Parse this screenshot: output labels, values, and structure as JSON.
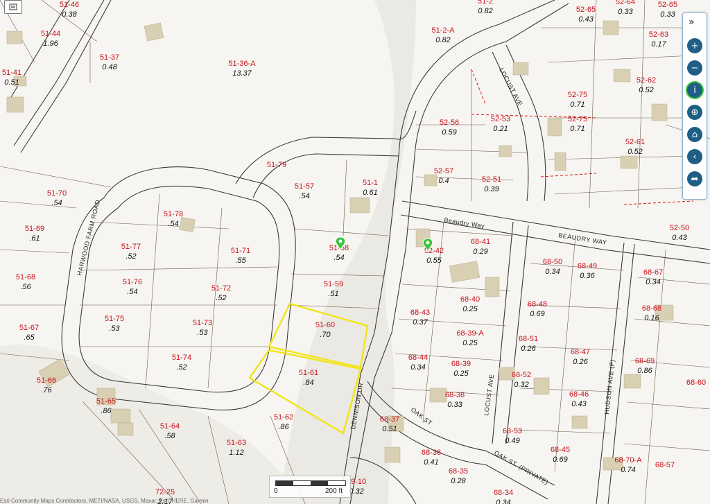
{
  "map": {
    "streets": [
      {
        "id": "harwood",
        "name": "HARWOOD FARM ROAD"
      },
      {
        "id": "dennison",
        "name": "DENNISON DR"
      },
      {
        "id": "locust-n",
        "name": "LOCUST AVE"
      },
      {
        "id": "locust-s",
        "name": "LOCUST AVE"
      },
      {
        "id": "beaudry-way",
        "name": "Beaudry Way"
      },
      {
        "id": "beaudry-way-2",
        "name": "BEAUDRY WAY"
      },
      {
        "id": "oak",
        "name": "OAK ST"
      },
      {
        "id": "oak-private",
        "name": "OAK ST. (PRIVATE)"
      },
      {
        "id": "hudson",
        "name": "HUDSON AVE (P)"
      }
    ],
    "parcels": [
      {
        "id": "51-46",
        "area": "0.38"
      },
      {
        "id": "51-44",
        "area": "1.96"
      },
      {
        "id": "51-41",
        "area": "0.51"
      },
      {
        "id": "51-37",
        "area": "0.48"
      },
      {
        "id": "51-36-A",
        "area": "13.37"
      },
      {
        "id": "51-2",
        "area": "0.82"
      },
      {
        "id": "51-2-A",
        "area": "0.82"
      },
      {
        "id": "52-65",
        "area": "0.43"
      },
      {
        "id": "52-64",
        "area": "0.33"
      },
      {
        "id": "52-65",
        "area": "0.33"
      },
      {
        "id": "52-63",
        "area": "0.17"
      },
      {
        "id": "52-62",
        "area": "0.52"
      },
      {
        "id": "52-75",
        "area": "0.71"
      },
      {
        "id": "52-75",
        "area": "0.71"
      },
      {
        "id": "52-56",
        "area": "0.59"
      },
      {
        "id": "52-53",
        "area": "0.21"
      },
      {
        "id": "52-61",
        "area": "0.52"
      },
      {
        "id": "52-57",
        "area": "0.4"
      },
      {
        "id": "52-51",
        "area": "0.39"
      },
      {
        "id": "51-79",
        "area": ""
      },
      {
        "id": "51-57",
        "area": ".54"
      },
      {
        "id": "51-1",
        "area": "0.61"
      },
      {
        "id": "51-70",
        "area": ".54"
      },
      {
        "id": "51-78",
        "area": ".54"
      },
      {
        "id": "51-69",
        "area": ".61"
      },
      {
        "id": "51-77",
        "area": ".52"
      },
      {
        "id": "51-71",
        "area": ".55"
      },
      {
        "id": "51-58",
        "area": ".54"
      },
      {
        "id": "52-42",
        "area": "0.55"
      },
      {
        "id": "68-41",
        "area": "0.29"
      },
      {
        "id": "52-50",
        "area": "0.43"
      },
      {
        "id": "51-68",
        "area": ".56"
      },
      {
        "id": "51-76",
        "area": ".54"
      },
      {
        "id": "51-72",
        "area": ".52"
      },
      {
        "id": "51-59",
        "area": ".51"
      },
      {
        "id": "68-50",
        "area": "0.34"
      },
      {
        "id": "68-49",
        "area": "0.36"
      },
      {
        "id": "68-67",
        "area": "0.34"
      },
      {
        "id": "68-40",
        "area": "0.25"
      },
      {
        "id": "68-48",
        "area": "0.69"
      },
      {
        "id": "68-68",
        "area": "0.16"
      },
      {
        "id": "68-43",
        "area": "0.37"
      },
      {
        "id": "51-67",
        "area": ".65"
      },
      {
        "id": "51-75",
        "area": ".53"
      },
      {
        "id": "51-73",
        "area": ".53"
      },
      {
        "id": "51-60",
        "area": ".70"
      },
      {
        "id": "68-39-A",
        "area": "0.25"
      },
      {
        "id": "68-51",
        "area": "0.26"
      },
      {
        "id": "68-47",
        "area": "0.26"
      },
      {
        "id": "51-74",
        "area": ".52"
      },
      {
        "id": "68-44",
        "area": "0.34"
      },
      {
        "id": "68-69",
        "area": "0.86"
      },
      {
        "id": "51-61",
        "area": ".84"
      },
      {
        "id": "68-39",
        "area": "0.25"
      },
      {
        "id": "68-52",
        "area": "0.32"
      },
      {
        "id": "51-66",
        "area": ".76"
      },
      {
        "id": "68-60",
        "area": ""
      },
      {
        "id": "51-65",
        "area": ".86"
      },
      {
        "id": "68-38",
        "area": "0.33"
      },
      {
        "id": "68-46",
        "area": "0.43"
      },
      {
        "id": "51-62",
        "area": ".86"
      },
      {
        "id": "68-37",
        "area": "0.51"
      },
      {
        "id": "51-64",
        "area": ".58"
      },
      {
        "id": "68-53",
        "area": "0.49"
      },
      {
        "id": "51-63",
        "area": "1.12"
      },
      {
        "id": "68-36",
        "area": "0.41"
      },
      {
        "id": "68-45",
        "area": "0.69"
      },
      {
        "id": "68-70-A",
        "area": "0.74"
      },
      {
        "id": "68-57",
        "area": ""
      },
      {
        "id": "68-35",
        "area": "0.28"
      },
      {
        "id": "72-25",
        "area": "2.17"
      },
      {
        "id": "69-10",
        "area": "0.32"
      },
      {
        "id": "68-34",
        "area": "0.34"
      }
    ],
    "highlight_color": "#f2e51d",
    "parcel_label_color": "#c8101a",
    "marker_color": "#3cc43c"
  },
  "toolbar": {
    "expand_icon": "double-chevron-right-icon",
    "expand_glyph": "»",
    "buttons": [
      {
        "id": "zoom-in",
        "icon": "plus-circle-icon",
        "glyph": "+"
      },
      {
        "id": "zoom-out",
        "icon": "minus-circle-icon",
        "glyph": "−"
      },
      {
        "id": "info",
        "icon": "info-icon",
        "glyph": "i"
      },
      {
        "id": "locate",
        "icon": "crosshair-icon",
        "glyph": "⊕"
      },
      {
        "id": "home",
        "icon": "home-icon",
        "glyph": "⌂"
      },
      {
        "id": "back",
        "icon": "arrow-left-icon",
        "glyph": "‹"
      },
      {
        "id": "share",
        "icon": "share-arrow-icon",
        "glyph": "➦"
      }
    ]
  },
  "scalebar": {
    "zero": "0",
    "max": "200 ft"
  },
  "attribution": "Esri Community Maps Contributors, METI/NASA, USGS, Maxar, Esri, HERE, Garmin"
}
